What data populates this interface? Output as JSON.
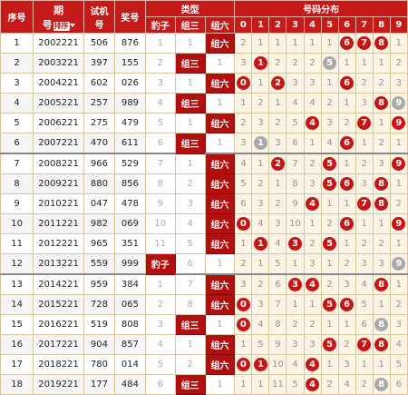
{
  "header": {
    "idx": "序号",
    "period_top": "期",
    "period_bottom": "号",
    "sort_label": "排序",
    "test_top": "试机",
    "test_bottom": "号",
    "win": "奖号",
    "type_group": "类型",
    "type_cols": [
      "豹子",
      "组三",
      "组六"
    ],
    "dist_group": "号码分布",
    "digits": [
      "0",
      "1",
      "2",
      "3",
      "4",
      "5",
      "6",
      "7",
      "8",
      "9"
    ]
  },
  "rows": [
    {
      "idx": "1",
      "period": "2002221",
      "test": "506",
      "win": "876",
      "types": [
        "1",
        "1",
        "组六"
      ],
      "hit": 2,
      "dist": [
        "2",
        "1",
        "1",
        "1",
        "1",
        "1",
        "6",
        "7",
        "8",
        "1"
      ],
      "balls": [
        6,
        7,
        8
      ],
      "gray": []
    },
    {
      "idx": "2",
      "period": "2003221",
      "test": "397",
      "win": "155",
      "types": [
        "2",
        "组三",
        "1"
      ],
      "hit": 1,
      "dist": [
        "3",
        "1",
        "2",
        "2",
        "2",
        "5",
        "1",
        "1",
        "1",
        "2"
      ],
      "balls": [
        1
      ],
      "gray": [
        5
      ]
    },
    {
      "idx": "3",
      "period": "2004221",
      "test": "602",
      "win": "026",
      "types": [
        "3",
        "1",
        "组六"
      ],
      "hit": 2,
      "dist": [
        "0",
        "1",
        "2",
        "3",
        "3",
        "1",
        "6",
        "2",
        "2",
        "3"
      ],
      "balls": [
        0,
        2,
        6
      ],
      "gray": []
    },
    {
      "idx": "4",
      "period": "2005221",
      "test": "257",
      "win": "989",
      "types": [
        "4",
        "组三",
        "1"
      ],
      "hit": 1,
      "dist": [
        "1",
        "2",
        "1",
        "4",
        "4",
        "2",
        "1",
        "3",
        "8",
        "9"
      ],
      "balls": [
        8
      ],
      "gray": [
        9
      ]
    },
    {
      "idx": "5",
      "period": "2006221",
      "test": "275",
      "win": "479",
      "types": [
        "5",
        "1",
        "组六"
      ],
      "hit": 2,
      "dist": [
        "2",
        "3",
        "2",
        "5",
        "4",
        "3",
        "2",
        "7",
        "1",
        "9"
      ],
      "balls": [
        4,
        7,
        9
      ],
      "gray": []
    },
    {
      "idx": "6",
      "period": "2007221",
      "test": "470",
      "win": "611",
      "types": [
        "6",
        "组三",
        "1"
      ],
      "hit": 1,
      "dist": [
        "3",
        "1",
        "3",
        "6",
        "1",
        "4",
        "6",
        "1",
        "2",
        "1"
      ],
      "balls": [
        6
      ],
      "gray": [
        1
      ]
    },
    {
      "idx": "7",
      "period": "2008221",
      "test": "966",
      "win": "529",
      "types": [
        "7",
        "1",
        "组六"
      ],
      "hit": 2,
      "dist": [
        "4",
        "1",
        "2",
        "7",
        "2",
        "5",
        "1",
        "2",
        "3",
        "9"
      ],
      "balls": [
        2,
        5,
        9
      ],
      "gray": []
    },
    {
      "idx": "8",
      "period": "2009221",
      "test": "880",
      "win": "856",
      "types": [
        "8",
        "2",
        "组六"
      ],
      "hit": 2,
      "dist": [
        "5",
        "2",
        "1",
        "8",
        "3",
        "5",
        "6",
        "3",
        "8",
        "1"
      ],
      "balls": [
        5,
        6,
        8
      ],
      "gray": []
    },
    {
      "idx": "9",
      "period": "2010221",
      "test": "047",
      "win": "478",
      "types": [
        "9",
        "3",
        "组六"
      ],
      "hit": 2,
      "dist": [
        "6",
        "3",
        "2",
        "9",
        "4",
        "1",
        "1",
        "7",
        "8",
        "2"
      ],
      "balls": [
        4,
        7,
        8
      ],
      "gray": []
    },
    {
      "idx": "10",
      "period": "2011221",
      "test": "982",
      "win": "069",
      "types": [
        "10",
        "4",
        "组六"
      ],
      "hit": 2,
      "dist": [
        "0",
        "4",
        "3",
        "10",
        "1",
        "2",
        "6",
        "1",
        "1",
        "9"
      ],
      "balls": [
        0,
        6,
        9
      ],
      "gray": []
    },
    {
      "idx": "11",
      "period": "2012221",
      "test": "965",
      "win": "351",
      "types": [
        "11",
        "5",
        "组六"
      ],
      "hit": 2,
      "dist": [
        "1",
        "1",
        "4",
        "3",
        "2",
        "5",
        "1",
        "2",
        "2",
        "1"
      ],
      "balls": [
        1,
        3,
        5
      ],
      "gray": []
    },
    {
      "idx": "12",
      "period": "2013221",
      "test": "559",
      "win": "999",
      "types": [
        "豹子",
        "6",
        "1"
      ],
      "hit": 0,
      "dist": [
        "2",
        "1",
        "5",
        "1",
        "3",
        "1",
        "2",
        "3",
        "3",
        "9"
      ],
      "balls": [],
      "gray": [
        9
      ]
    },
    {
      "idx": "13",
      "period": "2014221",
      "test": "959",
      "win": "384",
      "types": [
        "1",
        "7",
        "组六"
      ],
      "hit": 2,
      "dist": [
        "3",
        "2",
        "6",
        "3",
        "4",
        "2",
        "3",
        "4",
        "8",
        "1"
      ],
      "balls": [
        3,
        4,
        8
      ],
      "gray": []
    },
    {
      "idx": "14",
      "period": "2015221",
      "test": "728",
      "win": "065",
      "types": [
        "2",
        "8",
        "组六"
      ],
      "hit": 2,
      "dist": [
        "0",
        "3",
        "7",
        "1",
        "1",
        "5",
        "6",
        "5",
        "1",
        "2"
      ],
      "balls": [
        0,
        5,
        6
      ],
      "gray": []
    },
    {
      "idx": "15",
      "period": "2016221",
      "test": "519",
      "win": "808",
      "types": [
        "3",
        "组三",
        "1"
      ],
      "hit": 1,
      "dist": [
        "0",
        "4",
        "8",
        "2",
        "2",
        "1",
        "1",
        "6",
        "8",
        "3"
      ],
      "balls": [
        0
      ],
      "gray": [
        8
      ]
    },
    {
      "idx": "16",
      "period": "2017221",
      "test": "904",
      "win": "857",
      "types": [
        "4",
        "1",
        "组六"
      ],
      "hit": 2,
      "dist": [
        "1",
        "5",
        "9",
        "3",
        "3",
        "5",
        "2",
        "7",
        "8",
        "4"
      ],
      "balls": [
        5,
        7,
        8
      ],
      "gray": []
    },
    {
      "idx": "17",
      "period": "2018221",
      "test": "780",
      "win": "014",
      "types": [
        "5",
        "2",
        "组六"
      ],
      "hit": 2,
      "dist": [
        "0",
        "1",
        "10",
        "4",
        "4",
        "1",
        "3",
        "1",
        "1",
        "5"
      ],
      "balls": [
        0,
        1,
        4
      ],
      "gray": []
    },
    {
      "idx": "18",
      "period": "2019221",
      "test": "177",
      "win": "484",
      "types": [
        "6",
        "组三",
        "1"
      ],
      "hit": 1,
      "dist": [
        "1",
        "1",
        "11",
        "5",
        "4",
        "2",
        "4",
        "2",
        "8",
        "6"
      ],
      "balls": [
        4
      ],
      "gray": [
        8
      ]
    }
  ],
  "separators_after": [
    6,
    12
  ],
  "colors": {
    "header_red": "#c41a1a",
    "ball_red": "#c81414",
    "ball_gray": "#a9a9a9",
    "dist_bg": "#fbf4e4"
  }
}
